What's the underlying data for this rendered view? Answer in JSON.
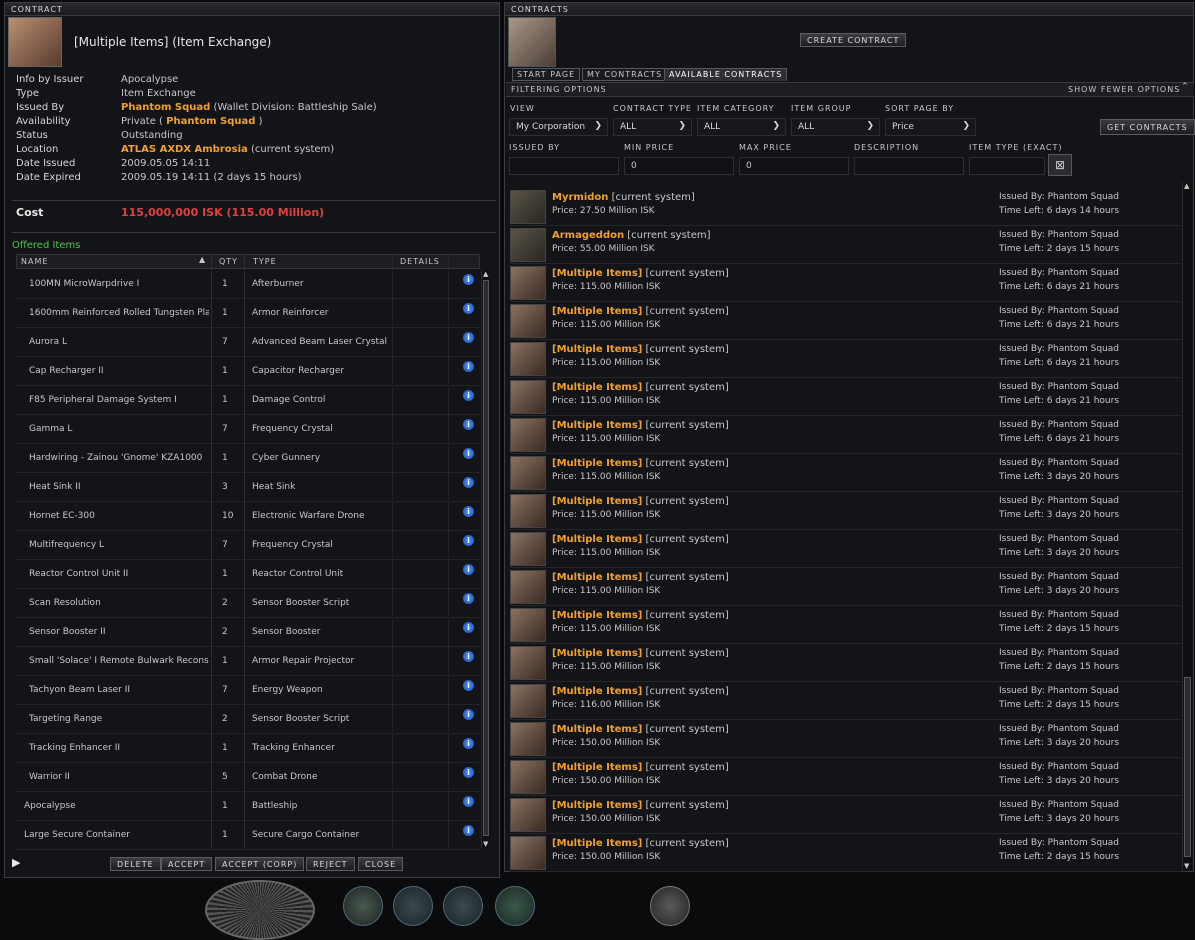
{
  "contract": {
    "window_title": "CONTRACT",
    "heading": "[Multiple Items] (Item Exchange)",
    "info": [
      {
        "key": "Info by Issuer",
        "value": "Apocalypse"
      },
      {
        "key": "Type",
        "value": "Item Exchange"
      },
      {
        "key": "Issued By",
        "value": "Phantom Squad",
        "extra": "(Wallet Division: Battleship Sale)"
      },
      {
        "key": "Availability",
        "value": "Private (",
        "highlight": "Phantom Squad",
        "after": ")"
      },
      {
        "key": "Status",
        "value": "Outstanding"
      },
      {
        "key": "Location",
        "value": "ATLAS AXDX Ambrosia",
        "extra": "(current system)"
      },
      {
        "key": "Date Issued",
        "value": "2009.05.05 14:11"
      },
      {
        "key": "Date Expired",
        "value": "2009.05.19 14:11 (2 days 15 hours)"
      }
    ],
    "cost_label": "Cost",
    "cost_value": "115,000,000 ISK (115.00 Million)",
    "offered_label": "Offered Items",
    "columns": [
      "NAME",
      "QTY",
      "TYPE",
      "DETAILS"
    ],
    "items": [
      {
        "name": "100MN MicroWarpdrive I",
        "qty": "1",
        "type": "Afterburner"
      },
      {
        "name": "1600mm Reinforced Rolled Tungsten Pla",
        "qty": "1",
        "type": "Armor Reinforcer"
      },
      {
        "name": "Aurora L",
        "qty": "7",
        "type": "Advanced Beam Laser Crystal"
      },
      {
        "name": "Cap Recharger II",
        "qty": "1",
        "type": "Capacitor Recharger"
      },
      {
        "name": "F85 Peripheral Damage System I",
        "qty": "1",
        "type": "Damage Control"
      },
      {
        "name": "Gamma L",
        "qty": "7",
        "type": "Frequency Crystal"
      },
      {
        "name": "Hardwiring - Zainou 'Gnome' KZA1000",
        "qty": "1",
        "type": "Cyber Gunnery"
      },
      {
        "name": "Heat Sink II",
        "qty": "3",
        "type": "Heat Sink"
      },
      {
        "name": "Hornet EC-300",
        "qty": "10",
        "type": "Electronic Warfare Drone"
      },
      {
        "name": "Multifrequency L",
        "qty": "7",
        "type": "Frequency Crystal"
      },
      {
        "name": "Reactor Control Unit II",
        "qty": "1",
        "type": "Reactor Control Unit"
      },
      {
        "name": "Scan Resolution",
        "qty": "2",
        "type": "Sensor Booster Script"
      },
      {
        "name": "Sensor Booster II",
        "qty": "2",
        "type": "Sensor Booster"
      },
      {
        "name": "Small 'Solace' I Remote Bulwark Recons",
        "qty": "1",
        "type": "Armor Repair Projector"
      },
      {
        "name": "Tachyon Beam Laser II",
        "qty": "7",
        "type": "Energy Weapon"
      },
      {
        "name": "Targeting Range",
        "qty": "2",
        "type": "Sensor Booster Script"
      },
      {
        "name": "Tracking Enhancer II",
        "qty": "1",
        "type": "Tracking Enhancer"
      },
      {
        "name": "Warrior II",
        "qty": "5",
        "type": "Combat Drone"
      },
      {
        "name": "Apocalypse",
        "qty": "1",
        "type": "Battleship"
      },
      {
        "name": "Large Secure Container",
        "qty": "1",
        "type": "Secure Cargo Container"
      }
    ],
    "buttons": {
      "delete": "DELETE",
      "accept": "ACCEPT",
      "accept_corp": "ACCEPT (CORP)",
      "reject": "REJECT",
      "close": "CLOSE"
    }
  },
  "contracts": {
    "window_title": "CONTRACTS",
    "create_button": "CREATE CONTRACT",
    "tabs": [
      "START PAGE",
      "MY CONTRACTS",
      "AVAILABLE CONTRACTS"
    ],
    "filtering_label": "FILTERING OPTIONS",
    "fewer_label": "SHOW FEWER OPTIONS",
    "filters": {
      "view_label": "VIEW",
      "view_value": "My Corporation",
      "ctype_label": "CONTRACT TYPE",
      "ctype_value": "ALL",
      "icat_label": "ITEM CATEGORY",
      "icat_value": "ALL",
      "igroup_label": "ITEM GROUP",
      "igroup_value": "ALL",
      "sort_label": "SORT PAGE BY",
      "sort_value": "Price",
      "get_button": "GET CONTRACTS",
      "issued_label": "ISSUED BY",
      "issued_value": "",
      "minp_label": "MIN PRICE",
      "minp_value": "0",
      "maxp_label": "MAX PRICE",
      "maxp_value": "0",
      "desc_label": "DESCRIPTION",
      "desc_value": "",
      "itype_label": "ITEM TYPE (EXACT)",
      "itype_value": ""
    },
    "rows": [
      {
        "title": "Myrmidon",
        "loc": "[current system]",
        "price": "Price: 27.50 Million ISK",
        "issuer": "Issued By: Phantom Squad",
        "time": "Time Left: 6 days 14 hours",
        "ship": true
      },
      {
        "title": "Armageddon",
        "loc": "[current system]",
        "price": "Price: 55.00 Million ISK",
        "issuer": "Issued By: Phantom Squad",
        "time": "Time Left: 2 days 15 hours",
        "ship": true
      },
      {
        "title": "[Multiple Items]",
        "loc": "[current system]",
        "price": "Price: 115.00 Million ISK",
        "issuer": "Issued By: Phantom Squad",
        "time": "Time Left: 6 days 21 hours"
      },
      {
        "title": "[Multiple Items]",
        "loc": "[current system]",
        "price": "Price: 115.00 Million ISK",
        "issuer": "Issued By: Phantom Squad",
        "time": "Time Left: 6 days 21 hours"
      },
      {
        "title": "[Multiple Items]",
        "loc": "[current system]",
        "price": "Price: 115.00 Million ISK",
        "issuer": "Issued By: Phantom Squad",
        "time": "Time Left: 6 days 21 hours"
      },
      {
        "title": "[Multiple Items]",
        "loc": "[current system]",
        "price": "Price: 115.00 Million ISK",
        "issuer": "Issued By: Phantom Squad",
        "time": "Time Left: 6 days 21 hours"
      },
      {
        "title": "[Multiple Items]",
        "loc": "[current system]",
        "price": "Price: 115.00 Million ISK",
        "issuer": "Issued By: Phantom Squad",
        "time": "Time Left: 6 days 21 hours"
      },
      {
        "title": "[Multiple Items]",
        "loc": "[current system]",
        "price": "Price: 115.00 Million ISK",
        "issuer": "Issued By: Phantom Squad",
        "time": "Time Left: 3 days 20 hours"
      },
      {
        "title": "[Multiple Items]",
        "loc": "[current system]",
        "price": "Price: 115.00 Million ISK",
        "issuer": "Issued By: Phantom Squad",
        "time": "Time Left: 3 days 20 hours"
      },
      {
        "title": "[Multiple Items]",
        "loc": "[current system]",
        "price": "Price: 115.00 Million ISK",
        "issuer": "Issued By: Phantom Squad",
        "time": "Time Left: 3 days 20 hours"
      },
      {
        "title": "[Multiple Items]",
        "loc": "[current system]",
        "price": "Price: 115.00 Million ISK",
        "issuer": "Issued By: Phantom Squad",
        "time": "Time Left: 3 days 20 hours"
      },
      {
        "title": "[Multiple Items]",
        "loc": "[current system]",
        "price": "Price: 115.00 Million ISK",
        "issuer": "Issued By: Phantom Squad",
        "time": "Time Left: 2 days 15 hours"
      },
      {
        "title": "[Multiple Items]",
        "loc": "[current system]",
        "price": "Price: 115.00 Million ISK",
        "issuer": "Issued By: Phantom Squad",
        "time": "Time Left: 2 days 15 hours"
      },
      {
        "title": "[Multiple Items]",
        "loc": "[current system]",
        "price": "Price: 116.00 Million ISK",
        "issuer": "Issued By: Phantom Squad",
        "time": "Time Left: 2 days 15 hours"
      },
      {
        "title": "[Multiple Items]",
        "loc": "[current system]",
        "price": "Price: 150.00 Million ISK",
        "issuer": "Issued By: Phantom Squad",
        "time": "Time Left: 3 days 20 hours"
      },
      {
        "title": "[Multiple Items]",
        "loc": "[current system]",
        "price": "Price: 150.00 Million ISK",
        "issuer": "Issued By: Phantom Squad",
        "time": "Time Left: 3 days 20 hours"
      },
      {
        "title": "[Multiple Items]",
        "loc": "[current system]",
        "price": "Price: 150.00 Million ISK",
        "issuer": "Issued By: Phantom Squad",
        "time": "Time Left: 3 days 20 hours"
      },
      {
        "title": "[Multiple Items]",
        "loc": "[current system]",
        "price": "Price: 150.00 Million ISK",
        "issuer": "Issued By: Phantom Squad",
        "time": "Time Left: 2 days 15 hours"
      }
    ]
  }
}
